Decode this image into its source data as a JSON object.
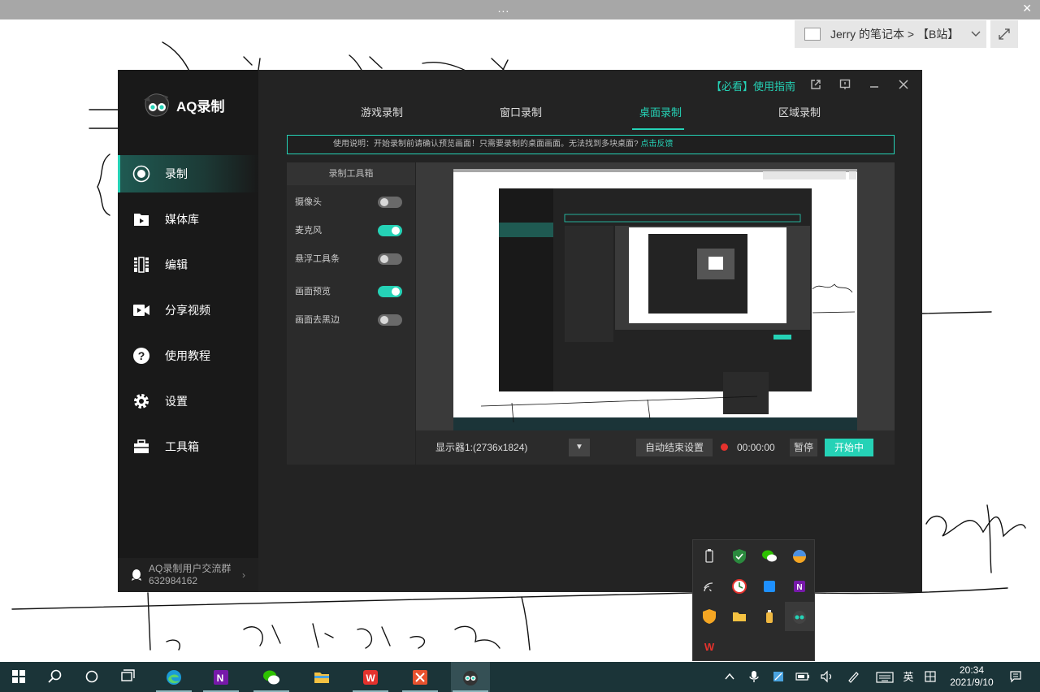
{
  "onenote": {
    "top_dots": "...",
    "top_close": "✕",
    "notebook_label": "Jerry 的笔记本 > 【B站】",
    "notebook_dropdown_icon": "chevron-down-icon",
    "expand_icon": "expand-icon"
  },
  "app": {
    "name": "AQ录制",
    "guide_link": "【必看】使用指南",
    "tabs": [
      "游戏录制",
      "窗口录制",
      "桌面录制",
      "区域录制"
    ],
    "active_tab": "桌面录制",
    "sidebar": [
      {
        "label": "录制",
        "icon": "record-icon"
      },
      {
        "label": "媒体库",
        "icon": "folder-icon"
      },
      {
        "label": "编辑",
        "icon": "film-icon"
      },
      {
        "label": "分享视频",
        "icon": "video-camera-icon"
      },
      {
        "label": "使用教程",
        "icon": "help-icon"
      },
      {
        "label": "设置",
        "icon": "gear-icon"
      },
      {
        "label": "工具箱",
        "icon": "toolbox-icon"
      }
    ],
    "active_nav": "录制",
    "group": {
      "line1": "AQ录制用户交流群",
      "line2": "632984162"
    },
    "notice": {
      "text": "使用说明：开始录制前请确认预览画面！只需要录制的桌面画面。无法找到多块桌面?",
      "link": "点击反馈"
    },
    "toolbox": {
      "title": "录制工具箱",
      "options": [
        {
          "label": "摄像头",
          "on": false
        },
        {
          "label": "麦克风",
          "on": true
        },
        {
          "label": "悬浮工具条",
          "on": false
        },
        {
          "label": "画面预览",
          "on": true
        },
        {
          "label": "画面去黑边",
          "on": false
        }
      ]
    },
    "display_select": "显示器1:(2736x1824)",
    "auto_end_button": "自动结束设置",
    "timer": "00:00:00",
    "pause_button": "暂停",
    "start_button": "开始中"
  },
  "tray_icons": [
    "usb-icon",
    "shield-icon",
    "wechat-icon",
    "color-ball-icon",
    "wifi-icon",
    "clock-icon",
    "app-blue-icon",
    "onenote-icon",
    "security-icon",
    "folder-icon",
    "bottle-icon",
    "aq-icon",
    "wps-icon"
  ],
  "taskbar": {
    "apps": [
      "edge-icon",
      "onenote-icon",
      "wechat-icon",
      "file-explorer-icon",
      "wps-icon",
      "xmind-icon",
      "aq-record-icon"
    ],
    "ime": "英",
    "clock_time": "20:34",
    "clock_date": "2021/9/10"
  },
  "colors": {
    "accent": "#25d2b6",
    "sidebar": "#191919",
    "panel": "#232323",
    "taskbar": "#1b3438",
    "rec": "#e5322d"
  }
}
